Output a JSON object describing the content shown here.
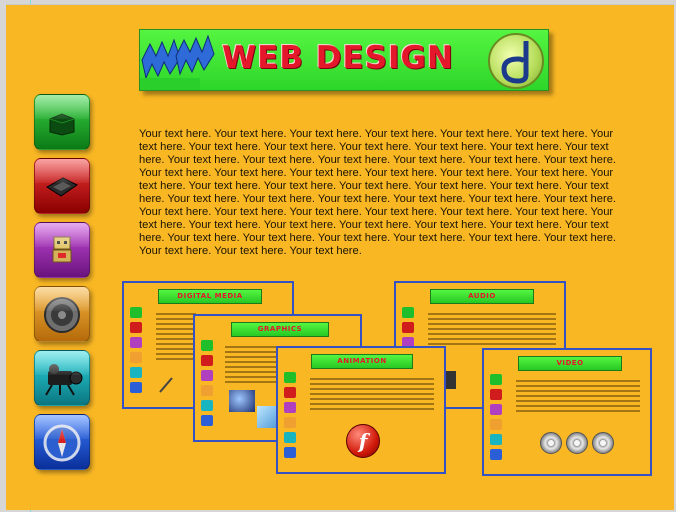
{
  "banner": {
    "title": "WEB DESIGN",
    "www": "WWW"
  },
  "nav": [
    {
      "name": "nav-button-green",
      "icon": "package-icon"
    },
    {
      "name": "nav-button-red",
      "icon": "tablet-icon"
    },
    {
      "name": "nav-button-purple",
      "icon": "robot-icon"
    },
    {
      "name": "nav-button-orange",
      "icon": "speaker-icon"
    },
    {
      "name": "nav-button-teal",
      "icon": "camera-icon"
    },
    {
      "name": "nav-button-blue",
      "icon": "compass-icon"
    }
  ],
  "body_text": "Your text here. Your text here. Your text here. Your text here. Your text here. Your text here. Your text here. Your text here. Your text here. Your text here. Your text here. Your text here. Your text here. Your text here. Your text here. Your text here. Your text here. Your text here. Your text here. Your text here. Your text here. Your text here. Your text here. Your text here. Your text here. Your text here. Your text here. Your text here. Your text here. Your text here. Your text here. Your text here. Your text here. Your text here. Your text here. Your text here. Your text here. Your text here. Your text here. Your text here. Your text here. Your text here. Your text here. Your text here. Your text here. Your text here. Your text here. Your text here. Your text here. Your text here. Your text here. Your text here. Your text here. Your text here. Your text here. Your text here. Your text here. Your text here. Your text here. Your text here.",
  "thumbs": {
    "digital_media": {
      "title": "DIGITAL MEDIA"
    },
    "graphics": {
      "title": "GRAPHICS"
    },
    "animation": {
      "title": "ANIMATION"
    },
    "audio": {
      "title": "AUDIO"
    },
    "video": {
      "title": "VIDEO"
    }
  },
  "colors": {
    "canvas": "#f9b724",
    "banner_green": "#55f541",
    "title_red": "#e5182b",
    "thumb_border": "#3452c5"
  }
}
